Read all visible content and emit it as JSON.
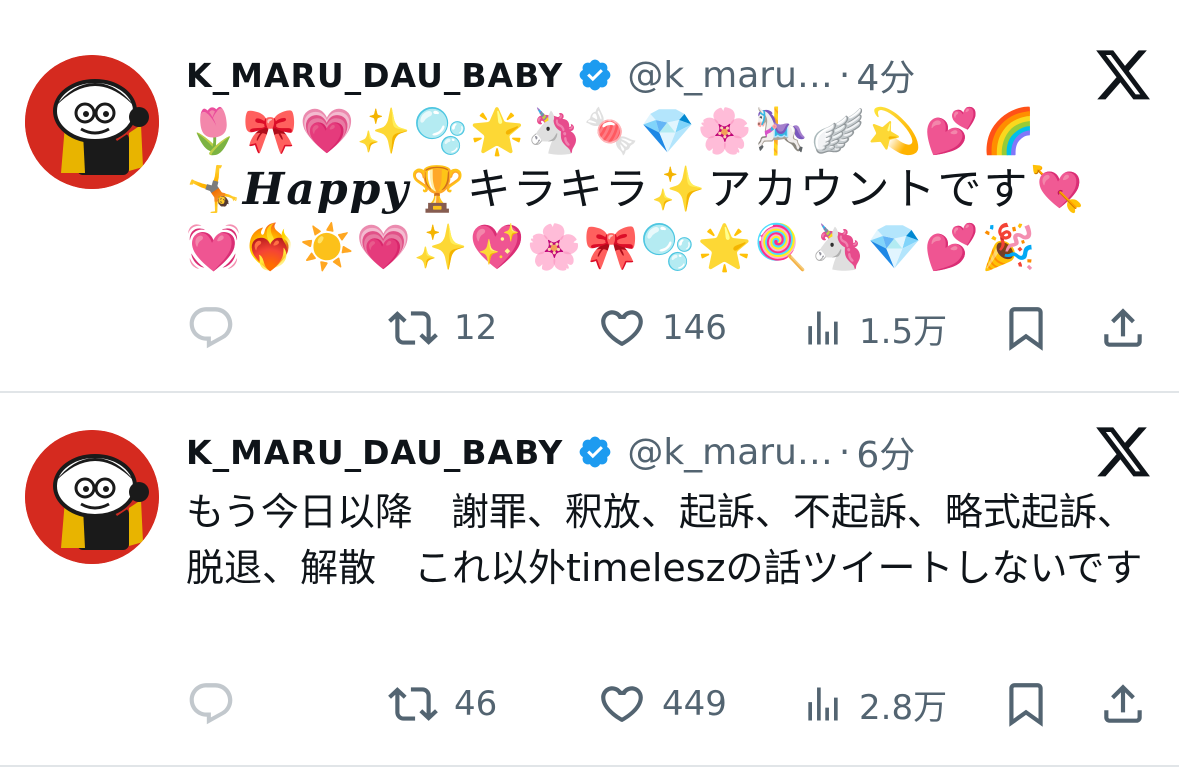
{
  "colors": {
    "text": "#0f1419",
    "secondary": "#536471",
    "verified": "#1d9bf0",
    "divider": "#e1e5e8",
    "avatar_bg": "#d52a1f"
  },
  "tweets": [
    {
      "display_name": "K_MARU_DAU_BABY",
      "handle": "@k_maru…",
      "separator": "·",
      "time": "4分",
      "text_line1": "🌷🎀💗✨🫧🌟🦄🍬💎🌸🎠🪽💫💕🌈",
      "text_line2_pre": "🤸",
      "text_line2_happy": "𝑯𝒂𝒑𝒑𝒚",
      "text_line2_post": "🏆キラキラ✨アカウントです💘",
      "text_line3": "💓❤️‍🔥☀️💗✨💖🌸🎀🫧🌟🍭🦄💎💕🎉",
      "actions": {
        "reply": "",
        "retweets": "12",
        "likes": "146",
        "views": "1.5万"
      }
    },
    {
      "display_name": "K_MARU_DAU_BABY",
      "handle": "@k_maru…",
      "separator": "·",
      "time": "6分",
      "text": "もう今日以降　謝罪、釈放、起訴、不起訴、略式起訴、脱退、解散　これ以外timeleszの話ツイートしないです",
      "actions": {
        "reply": "",
        "retweets": "46",
        "likes": "449",
        "views": "2.8万"
      }
    }
  ],
  "icons": {
    "verified": "verified-badge-icon",
    "x_logo": "x-logo-icon",
    "reply": "reply-icon",
    "retweet": "retweet-icon",
    "like": "heart-icon",
    "views": "views-chart-icon",
    "bookmark": "bookmark-icon",
    "share": "share-icon"
  }
}
